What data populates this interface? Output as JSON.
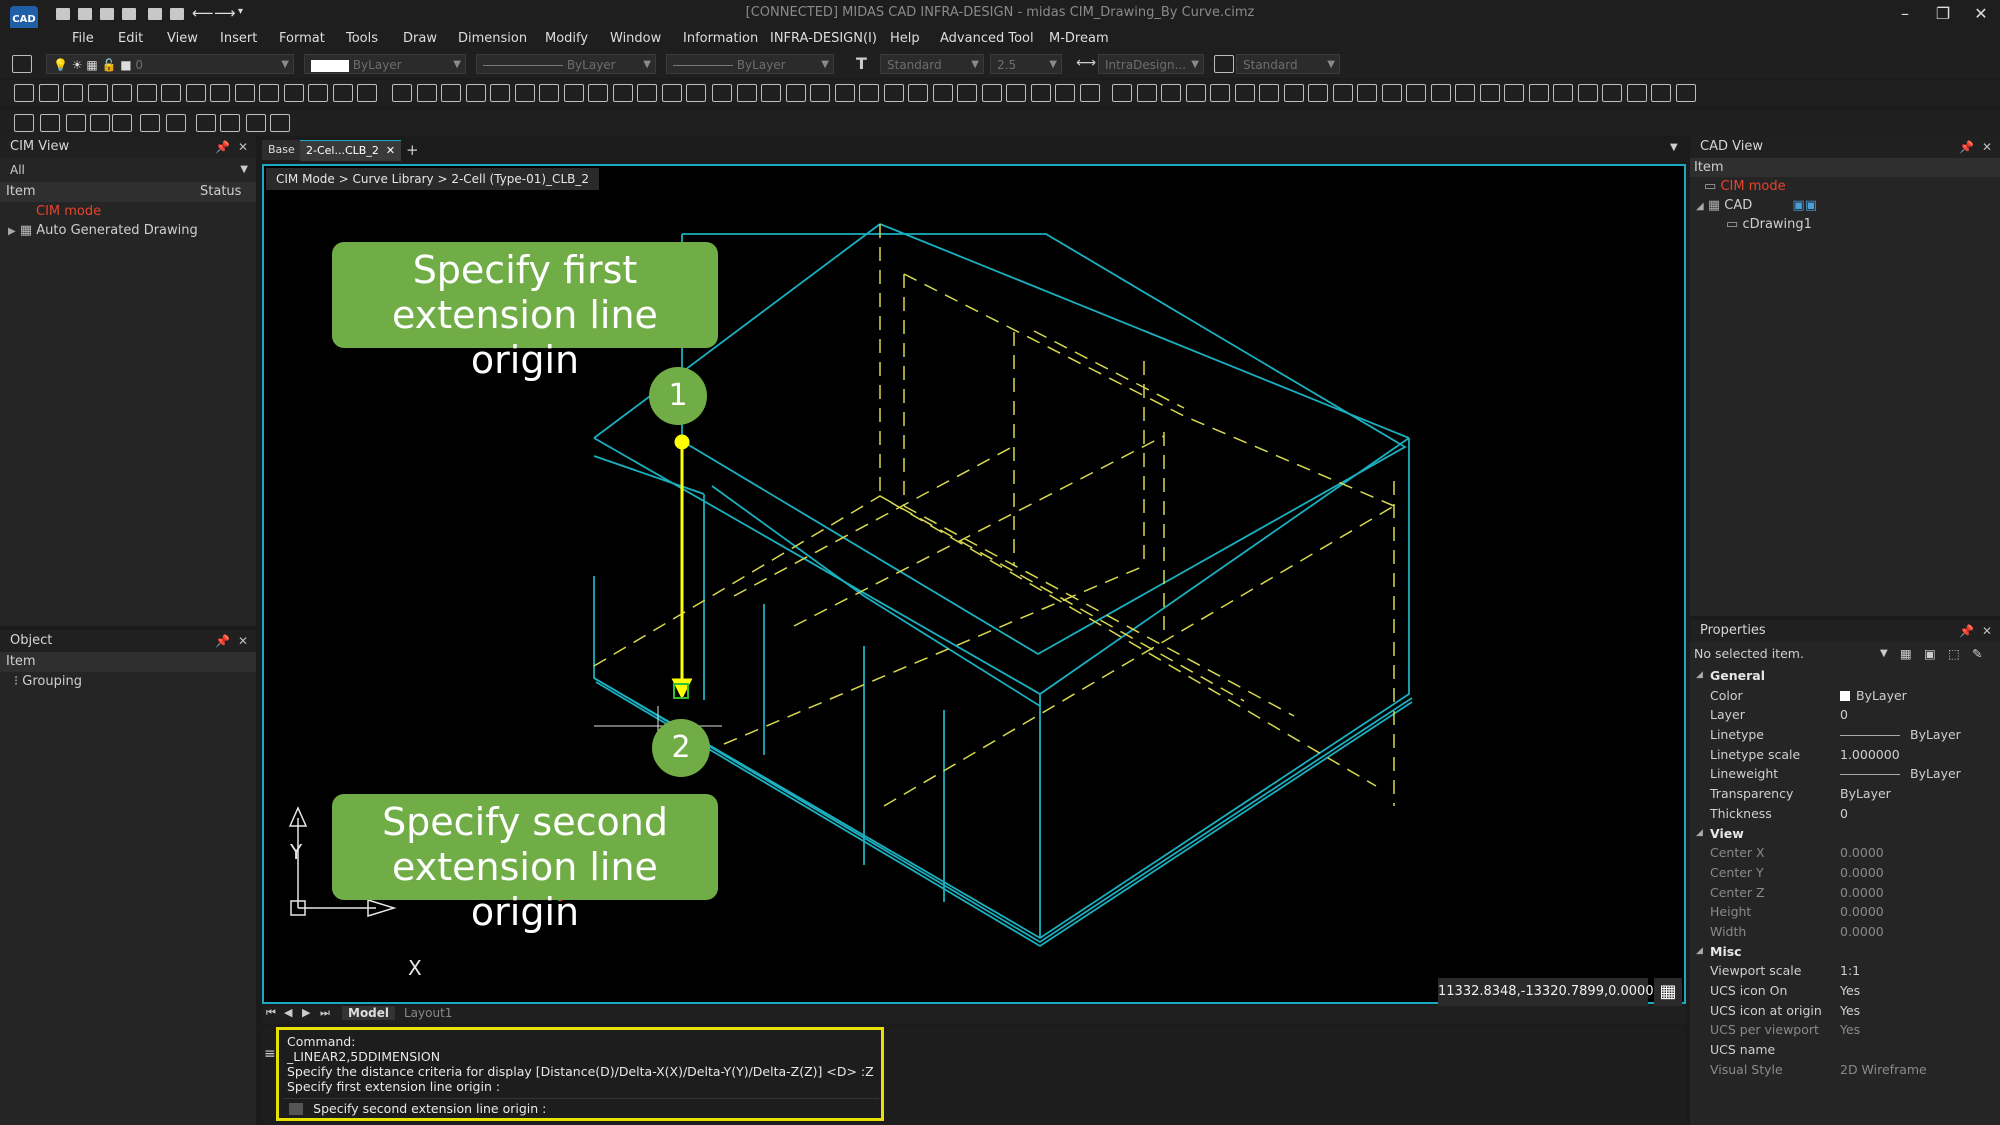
{
  "app": {
    "title": "[CONNECTED] MIDAS CAD INFRA-DESIGN - midas CIM_Drawing_By Curve.cimz",
    "logo": "CAD"
  },
  "menu": [
    "File",
    "Edit",
    "View",
    "Insert",
    "Format",
    "Tools",
    "Draw",
    "Dimension",
    "Modify",
    "Window",
    "Information",
    "INFRA-DESIGN(I)",
    "Help",
    "Advanced Tool",
    "M-Dream"
  ],
  "props_bar": {
    "layer_value": "0",
    "color": "ByLayer",
    "linetype": "ByLayer",
    "lineweight": "ByLayer",
    "text_style": "Standard",
    "text_height": "2.5",
    "dim_style": "IntraDesign...",
    "table_style": "Standard"
  },
  "cim_view": {
    "title": "CIM View",
    "filter": "All",
    "col_item": "Item",
    "col_status": "Status",
    "items": [
      "CIM mode",
      "Auto Generated Drawing"
    ]
  },
  "object_panel": {
    "title": "Object",
    "col_item": "Item",
    "items": [
      "Grouping"
    ]
  },
  "tabs": [
    "Base",
    "2-Cel...CLB_2"
  ],
  "breadcrumb": "CIM Mode > Curve Library > 2-Cell (Type-01)_CLB_2",
  "callouts": {
    "first": [
      "Specify first",
      "extension line origin"
    ],
    "second": [
      "Specify second",
      "extension line origin"
    ],
    "badge1": "1",
    "badge2": "2"
  },
  "ucs": {
    "y": "Y",
    "x": "X"
  },
  "coord_readout": "11332.8348,-13320.7899,0.0000",
  "layout_tabs": [
    "Model",
    "Layout1"
  ],
  "command": {
    "lines": [
      "Command:",
      "_LINEAR2,5DDIMENSION",
      "Specify the distance criteria for display [Distance(D)/Delta-X(X)/Delta-Y(Y)/Delta-Z(Z)] <D> :Z",
      "Specify first extension line origin :"
    ],
    "prompt": "Specify second extension line origin :"
  },
  "cad_view": {
    "title": "CAD View",
    "col_item": "Item",
    "items": [
      "CIM mode",
      "CAD",
      "cDrawing1"
    ]
  },
  "properties": {
    "title": "Properties",
    "selection": "No selected item.",
    "sections": [
      {
        "name": "General",
        "rows": [
          {
            "k": "Color",
            "v": "ByLayer"
          },
          {
            "k": "Layer",
            "v": "0"
          },
          {
            "k": "Linetype",
            "v": "ByLayer"
          },
          {
            "k": "Linetype scale",
            "v": "1.000000"
          },
          {
            "k": "Lineweight",
            "v": "ByLayer"
          },
          {
            "k": "Transparency",
            "v": "ByLayer"
          },
          {
            "k": "Thickness",
            "v": "0"
          }
        ]
      },
      {
        "name": "View",
        "rows": [
          {
            "k": "Center X",
            "v": "0.0000"
          },
          {
            "k": "Center Y",
            "v": "0.0000"
          },
          {
            "k": "Center Z",
            "v": "0.0000"
          },
          {
            "k": "Height",
            "v": "0.0000"
          },
          {
            "k": "Width",
            "v": "0.0000"
          }
        ]
      },
      {
        "name": "Misc",
        "rows": [
          {
            "k": "Viewport scale",
            "v": "1:1"
          },
          {
            "k": "UCS icon On",
            "v": "Yes"
          },
          {
            "k": "UCS icon at origin",
            "v": "Yes"
          },
          {
            "k": "UCS per viewport",
            "v": "Yes"
          },
          {
            "k": "UCS name",
            "v": ""
          },
          {
            "k": "Visual Style",
            "v": "2D Wireframe"
          }
        ]
      }
    ]
  },
  "colors": {
    "accent_cyan": "#1aa9c0",
    "callout_green": "#70ad47",
    "highlight_yellow": "#e8e000",
    "cim_mode_red": "#e8432b"
  }
}
